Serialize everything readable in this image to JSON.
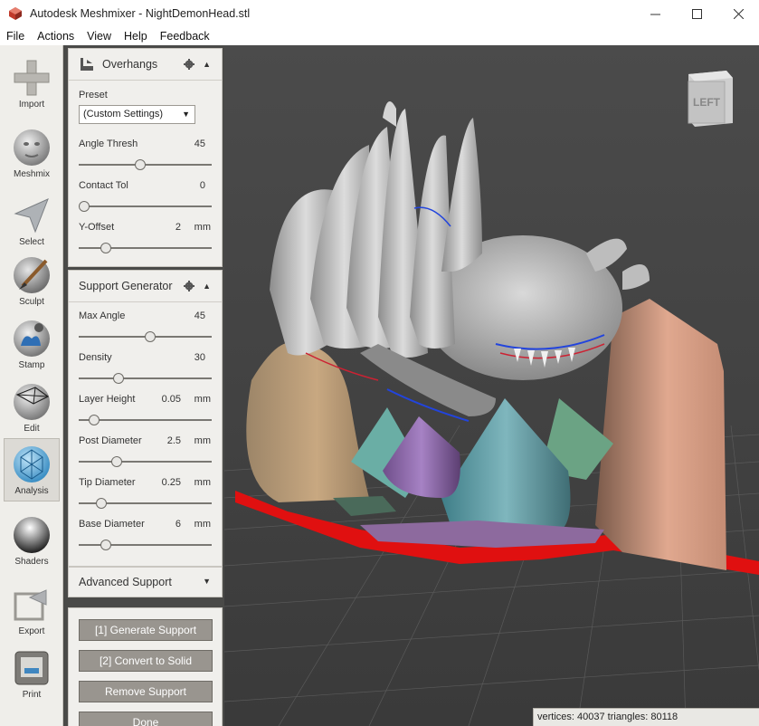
{
  "window": {
    "title": "Autodesk Meshmixer - NightDemonHead.stl",
    "controls": {
      "minimize": "—",
      "maximize": "☐",
      "close": "✕"
    }
  },
  "menu": [
    "File",
    "Actions",
    "View",
    "Help",
    "Feedback"
  ],
  "toolbar": {
    "tools": [
      {
        "label": "Import",
        "icon": "plus-icon"
      },
      {
        "label": "Meshmix",
        "icon": "face-sphere-icon"
      },
      {
        "label": "Select",
        "icon": "arrow-cursor-icon"
      },
      {
        "label": "Sculpt",
        "icon": "brush-icon"
      },
      {
        "label": "Stamp",
        "icon": "stamp-icon"
      },
      {
        "label": "Edit",
        "icon": "wireframe-icon"
      },
      {
        "label": "Analysis",
        "icon": "geodesic-sphere-icon"
      },
      {
        "label": "Shaders",
        "icon": "chrome-sphere-icon"
      },
      {
        "label": "Export",
        "icon": "export-icon"
      },
      {
        "label": "Print",
        "icon": "printer-icon"
      }
    ],
    "active_tool": "Analysis"
  },
  "overhangs": {
    "title": "Overhangs",
    "preset_label": "Preset",
    "preset_value": "(Custom Settings)",
    "angle_thresh": {
      "label": "Angle Thresh",
      "value": "45",
      "unit": "",
      "level": 0.46
    },
    "contact_tol": {
      "label": "Contact Tol",
      "value": "0",
      "unit": "",
      "level": 0.0
    },
    "y_offset": {
      "label": "Y-Offset",
      "value": "2",
      "unit": "mm",
      "level": 0.18
    }
  },
  "support_generator": {
    "title": "Support Generator",
    "max_angle": {
      "label": "Max Angle",
      "value": "45",
      "unit": "",
      "level": 0.54
    },
    "density": {
      "label": "Density",
      "value": "30",
      "unit": "",
      "level": 0.28
    },
    "layer_height": {
      "label": "Layer Height",
      "value": "0.05",
      "unit": "mm",
      "level": 0.08
    },
    "post_diameter": {
      "label": "Post Diameter",
      "value": "2.5",
      "unit": "mm",
      "level": 0.27
    },
    "tip_diameter": {
      "label": "Tip Diameter",
      "value": "0.25",
      "unit": "mm",
      "level": 0.14
    },
    "base_diameter": {
      "label": "Base Diameter",
      "value": "6",
      "unit": "mm",
      "level": 0.18
    }
  },
  "advanced_support": {
    "title": "Advanced Support"
  },
  "actions": {
    "generate": "[1] Generate Support",
    "convert": "[2] Convert to Solid",
    "remove": "Remove Support",
    "done": "Done"
  },
  "viewcube": {
    "label": "LEFT"
  },
  "status": {
    "text": "vertices: 40037  triangles: 80118"
  }
}
